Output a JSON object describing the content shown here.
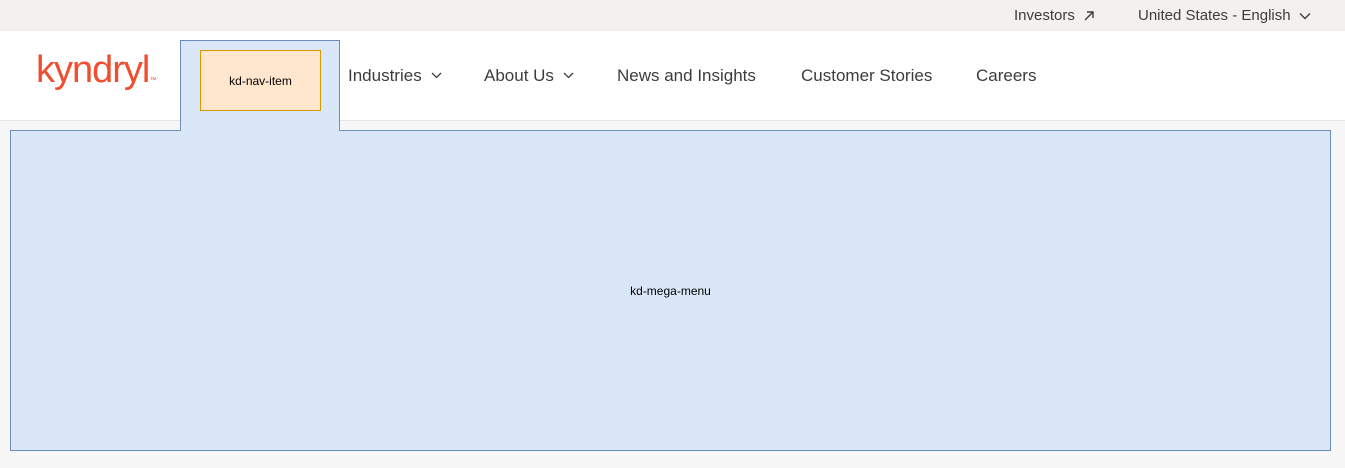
{
  "utility": {
    "investors_label": "Investors",
    "locale_label": "United States - English"
  },
  "logo": {
    "text": "kyndryl",
    "tm": "™",
    "color": "#f04e30"
  },
  "nav": {
    "item_placeholder": "kd-nav-item",
    "items": [
      {
        "label": "Industries",
        "has_dropdown": true
      },
      {
        "label": "About Us",
        "has_dropdown": true
      },
      {
        "label": "News and Insights",
        "has_dropdown": false
      },
      {
        "label": "Customer Stories",
        "has_dropdown": false
      },
      {
        "label": "Careers",
        "has_dropdown": false
      }
    ]
  },
  "mega_menu": {
    "label": "kd-mega-menu"
  },
  "colors": {
    "placeholder_fill": "#dae7f8",
    "placeholder_border": "#6c8ebf",
    "nav_item_fill": "#ffe6cc",
    "nav_item_border": "#d79b00",
    "utility_bg": "#f2f1ee",
    "text": "#3d3c3c"
  },
  "icons": {
    "investors": "arrow-up-right-icon",
    "locale": "chevron-down-icon",
    "nav_dropdown": "chevron-down-icon"
  }
}
